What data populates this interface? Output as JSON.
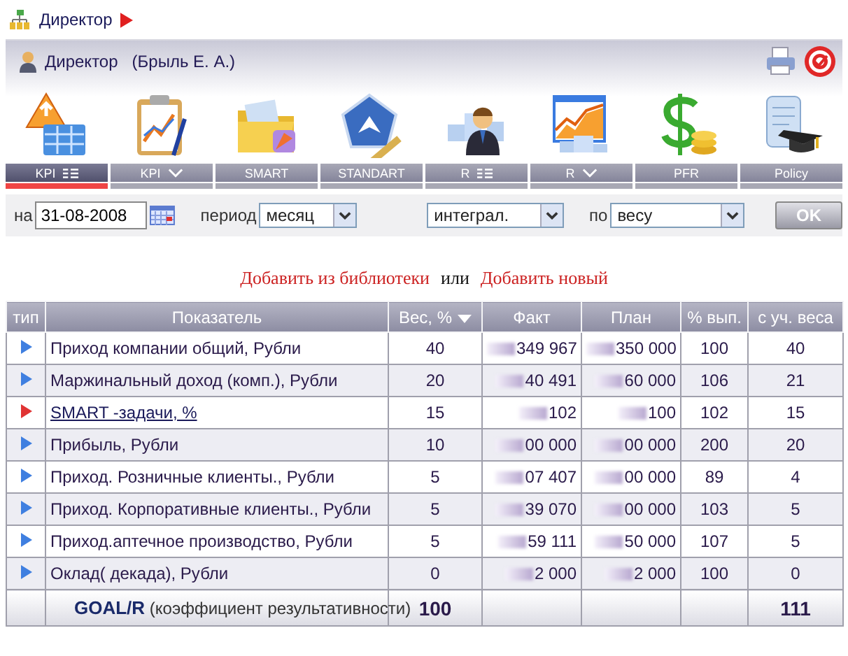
{
  "header": {
    "title": "Директор"
  },
  "user": {
    "role": "Директор",
    "name": "(Брыль Е. А.)"
  },
  "modules": [
    {
      "label": "KPI",
      "kind": "list",
      "selected": true
    },
    {
      "label": "KPI",
      "kind": "chevron",
      "selected": false
    },
    {
      "label": "SMART",
      "selected": false
    },
    {
      "label": "STANDART",
      "selected": false
    },
    {
      "label": "R",
      "kind": "list",
      "selected": false
    },
    {
      "label": "R",
      "kind": "chevron",
      "selected": false
    },
    {
      "label": "PFR",
      "selected": false
    },
    {
      "label": "Policy",
      "selected": false
    }
  ],
  "filters": {
    "date_label": "на",
    "date": "31-08-2008",
    "period_label": "период",
    "period": "месяц",
    "mode": "интеграл.",
    "by_label": "по",
    "by": "весу",
    "ok": "OK"
  },
  "actions": {
    "add_library": "Добавить из библиотеки",
    "or": "или",
    "add_new": "Добавить новый"
  },
  "table": {
    "columns": [
      {
        "label": "тип",
        "sorted": false
      },
      {
        "label": "Показатель",
        "sorted": false
      },
      {
        "label": "Вес, %",
        "sorted": true
      },
      {
        "label": "Факт",
        "sorted": false
      },
      {
        "label": "План",
        "sorted": false
      },
      {
        "label": "% вып.",
        "sorted": false
      },
      {
        "label": "с уч. веса",
        "sorted": false
      }
    ],
    "rows": [
      {
        "color": "#3f7fe0",
        "link": false,
        "name": "Приход компании общий, Рубли",
        "weight": "40",
        "fact": "349 967",
        "plan": "350 000",
        "percent": "100",
        "weighted": "40"
      },
      {
        "color": "#3f7fe0",
        "link": false,
        "name": "Маржинальный доход (комп.), Рубли",
        "weight": "20",
        "fact": "40 491",
        "plan": "60 000",
        "percent": "106",
        "weighted": "21"
      },
      {
        "color": "#e03434",
        "link": true,
        "name": "SMART -задачи, %",
        "weight": "15",
        "fact": "102",
        "plan": "100",
        "percent": "102",
        "weighted": "15"
      },
      {
        "color": "#3f7fe0",
        "link": false,
        "name": "Прибыль, Рубли",
        "weight": "10",
        "fact": "00 000",
        "plan": "00 000",
        "percent": "200",
        "weighted": "20"
      },
      {
        "color": "#3f7fe0",
        "link": false,
        "name": "Приход. Розничные клиенты., Рубли",
        "weight": "5",
        "fact": "07 407",
        "plan": "00 000",
        "percent": "89",
        "weighted": "4"
      },
      {
        "color": "#3f7fe0",
        "link": false,
        "name": "Приход. Корпоративные клиенты., Рубли",
        "weight": "5",
        "fact": "39 070",
        "plan": "00 000",
        "percent": "103",
        "weighted": "5"
      },
      {
        "color": "#3f7fe0",
        "link": false,
        "name": "Приход.аптечное производство, Рубли",
        "weight": "5",
        "fact": "59 111",
        "plan": "50 000",
        "percent": "107",
        "weighted": "5"
      },
      {
        "color": "#3f7fe0",
        "link": false,
        "name": "Оклад( декада), Рубли",
        "weight": "0",
        "fact": "2 000",
        "plan": "2 000",
        "percent": "100",
        "weighted": "0"
      }
    ],
    "footer": {
      "label": "GOAL/R",
      "note": "(коэффициент результативности)",
      "weight": "100",
      "weighted": "111"
    }
  }
}
